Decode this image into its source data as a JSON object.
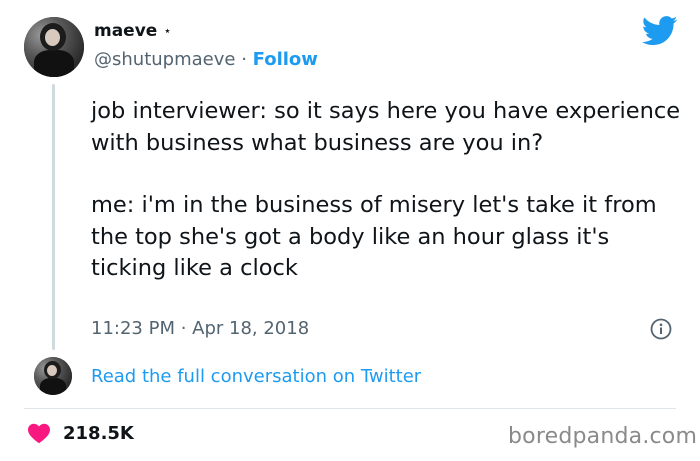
{
  "user": {
    "display_name": "maeve",
    "badge": "⋆",
    "handle": "@shutupmaeve",
    "separator": "·",
    "follow_label": "Follow"
  },
  "tweet": {
    "paragraph_1": "job interviewer: so it says here you have experience with business what business are you in?",
    "paragraph_2": "me: i'm in the business of misery let's take it from the top she's got a body like an hour glass it's ticking like a clock",
    "timestamp": "11:23 PM · Apr 18, 2018"
  },
  "conversation": {
    "link_label": "Read the full conversation on Twitter"
  },
  "engagement": {
    "likes": "218.5K"
  },
  "watermark": "boredpanda.com",
  "colors": {
    "accent": "#1d9bf0",
    "heart": "#f91880",
    "muted": "#536471"
  },
  "icons": {
    "brand": "twitter-bird-icon",
    "info": "info-icon",
    "like": "heart-icon"
  }
}
